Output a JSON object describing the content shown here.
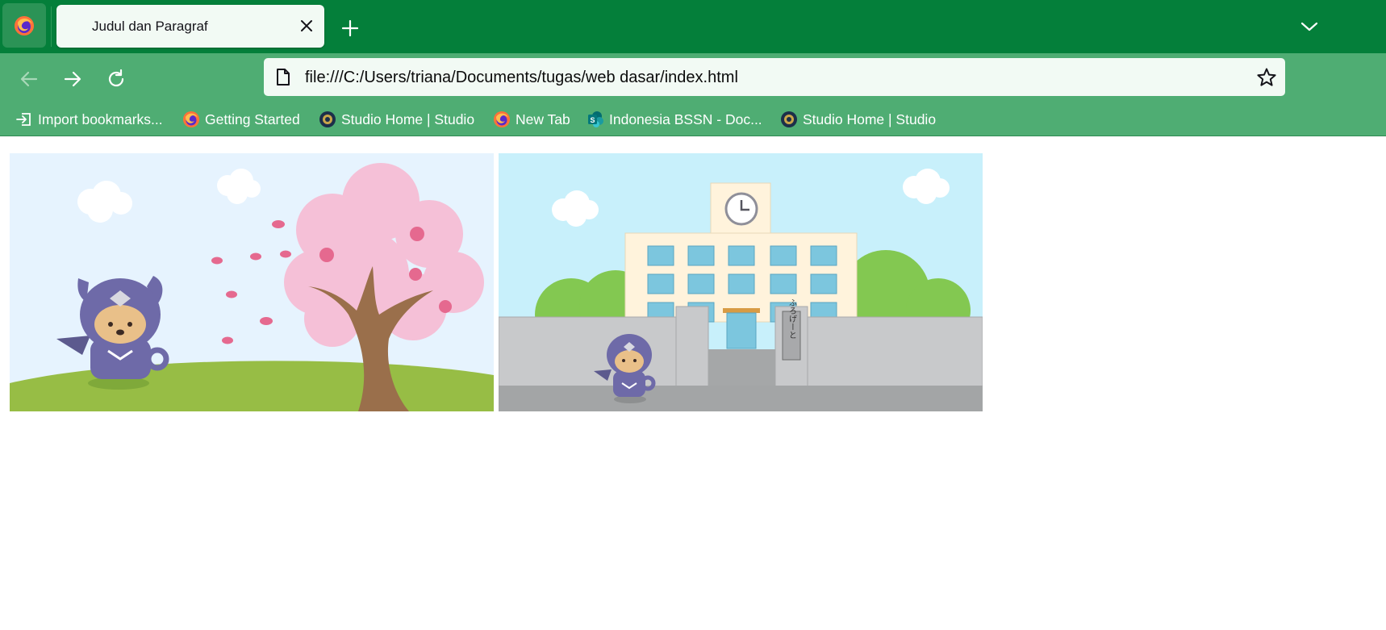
{
  "tab": {
    "title": "Judul dan Paragraf"
  },
  "address": {
    "url": "file:///C:/Users/triana/Documents/tugas/web dasar/index.html"
  },
  "bookmarks": [
    {
      "label": "Import bookmarks...",
      "icon": "import-icon"
    },
    {
      "label": "Getting Started",
      "icon": "firefox-icon"
    },
    {
      "label": "Studio Home | Studio",
      "icon": "studio-icon"
    },
    {
      "label": "New Tab",
      "icon": "firefox-icon"
    },
    {
      "label": "Indonesia BSSN - Doc...",
      "icon": "sharepoint-icon"
    },
    {
      "label": "Studio Home | Studio",
      "icon": "studio-icon"
    }
  ],
  "content": {
    "image_1": {
      "alt": "ninja cat beside cherry blossom tree"
    },
    "image_2": {
      "alt": "ninja cat in front of school building",
      "gate_sign": "ふろげーと"
    }
  },
  "colors": {
    "tabbar": "#047f3a",
    "toolbar": "#4fad73",
    "urlbar": "#f2faf4"
  }
}
